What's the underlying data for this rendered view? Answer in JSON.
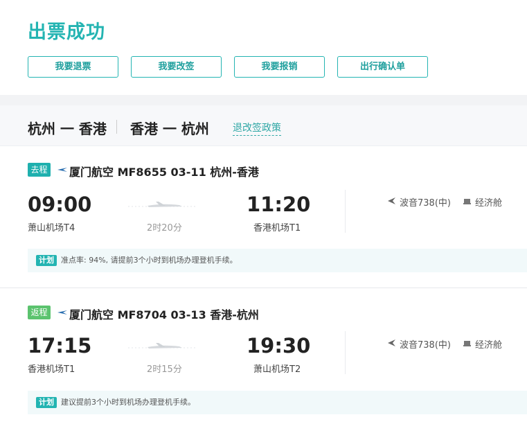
{
  "header": {
    "title": "出票成功",
    "buttons": [
      "我要退票",
      "我要改签",
      "我要报销",
      "出行确认单"
    ]
  },
  "routes": {
    "outbound_label": "杭州 一 香港",
    "return_label": "香港 一 杭州",
    "policy_link": "退改签政策"
  },
  "segments": [
    {
      "tag": "去程",
      "flight_line": "厦门航空 MF8655  03-11 杭州-香港",
      "depart_time": "09:00",
      "depart_airport": "萧山机场T4",
      "duration": "2时20分",
      "arrive_time": "11:20",
      "arrive_airport": "香港机场T1",
      "aircraft": "波音738(中)",
      "cabin": "经济舱",
      "plan_label": "计划",
      "note": "准点率: 94%, 请提前3个小时到机场办理登机手续。"
    },
    {
      "tag": "返程",
      "flight_line": "厦门航空 MF8704  03-13 香港-杭州",
      "depart_time": "17:15",
      "depart_airport": "香港机场T1",
      "duration": "2时15分",
      "arrive_time": "19:30",
      "arrive_airport": "萧山机场T2",
      "aircraft": "波音738(中)",
      "cabin": "经济舱",
      "plan_label": "计划",
      "note": "建议提前3个小时到机场办理登机手续。"
    }
  ],
  "colors": {
    "accent": "#23b4b2",
    "return_tag": "#5bc36e"
  },
  "icons": [
    "airline-logo-icon",
    "plane-illustration-icon",
    "airplane-icon",
    "seat-icon"
  ]
}
